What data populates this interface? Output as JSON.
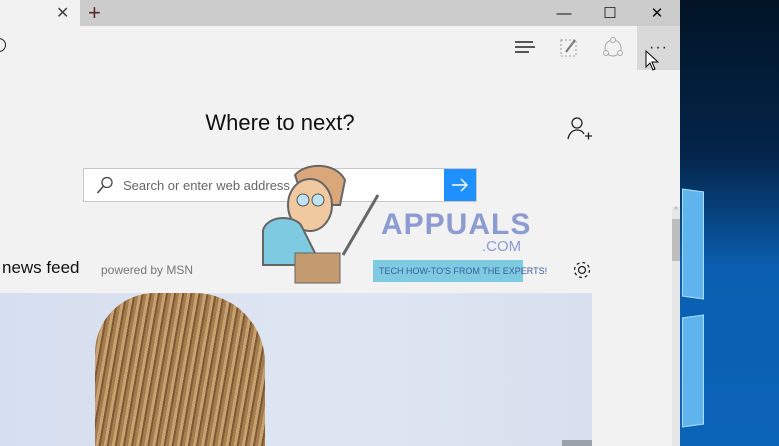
{
  "tabbar": {
    "close_tab": "✕",
    "new_tab": "+",
    "minimize": "—",
    "maximize": "☐",
    "close": "✕"
  },
  "toolbar": {
    "more_label": "···"
  },
  "start": {
    "heading": "Where to next?",
    "search_placeholder": "Search or enter web address",
    "search_value": ""
  },
  "news": {
    "title": "news feed",
    "powered_by": "powered by MSN"
  },
  "watermark": {
    "name": "APPUALS",
    "domain": ".COM",
    "tagline": "TECH HOW-TO'S FROM THE EXPERTS!"
  },
  "colors": {
    "accent": "#1e90ff",
    "tabbar": "#cccccc",
    "page_bg": "#f2f2f2"
  }
}
